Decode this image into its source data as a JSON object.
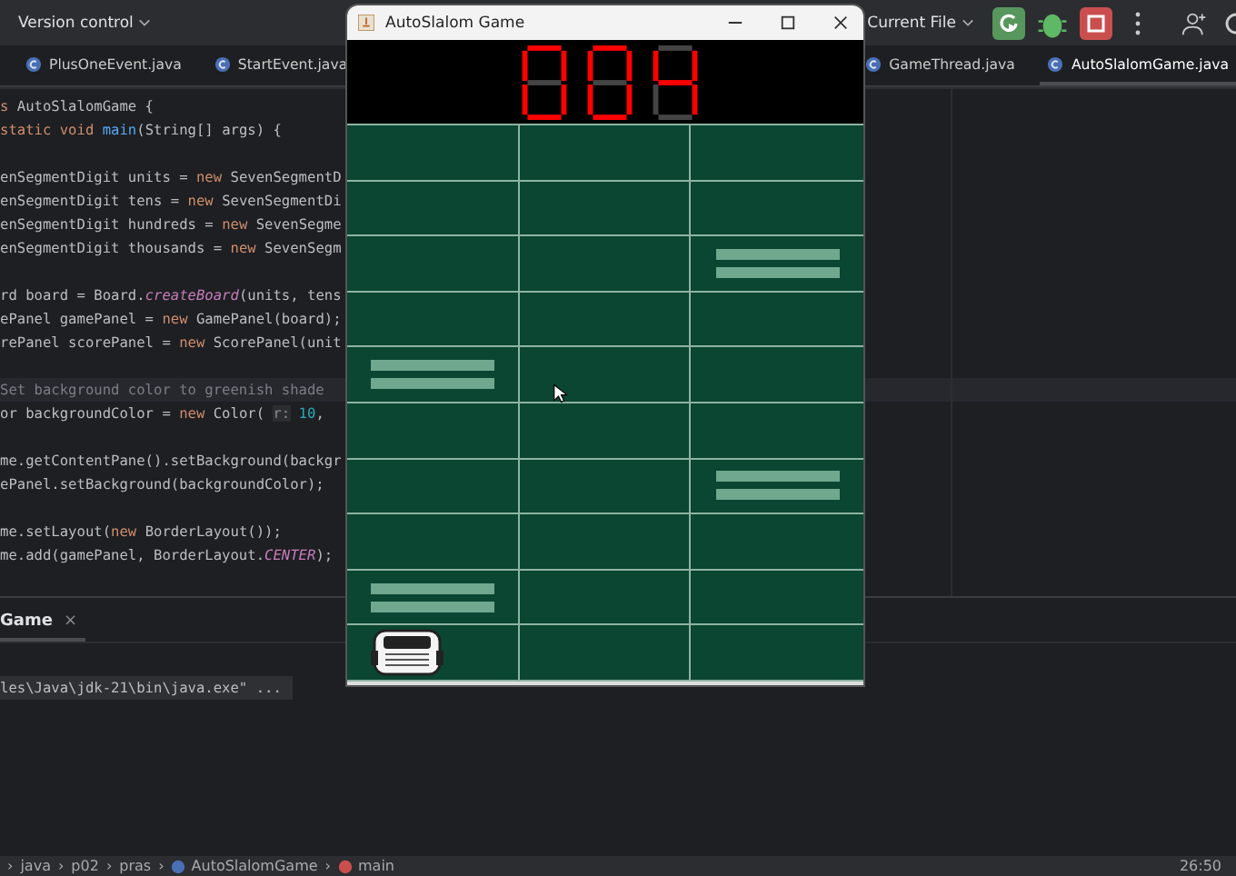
{
  "toolbar": {
    "vcs_label": "Version control",
    "run_config": "Current File"
  },
  "editor_tabs": [
    {
      "label": "PlusOneEvent.java",
      "selected": false
    },
    {
      "label": "StartEvent.java",
      "selected": false
    },
    {
      "label": "GameThread.java",
      "selected": false
    },
    {
      "label": "AutoSlalomGame.java",
      "selected": true
    }
  ],
  "code_lines": [
    {
      "tokens": [
        {
          "kind": "keyword",
          "text": "s "
        },
        {
          "kind": "plain",
          "text": "AutoSlalomGame {"
        }
      ]
    },
    {
      "tokens": [
        {
          "kind": "keyword",
          "text": "static void "
        },
        {
          "kind": "method",
          "text": "main"
        },
        {
          "kind": "plain",
          "text": "(String[] args) {"
        }
      ]
    },
    {
      "blank_before": true,
      "tokens": [
        {
          "kind": "plain",
          "text": "enSegmentDigit units = "
        },
        {
          "kind": "keyword",
          "text": "new "
        },
        {
          "kind": "plain",
          "text": "SevenSegmentD"
        }
      ]
    },
    {
      "tokens": [
        {
          "kind": "plain",
          "text": "enSegmentDigit tens = "
        },
        {
          "kind": "keyword",
          "text": "new "
        },
        {
          "kind": "plain",
          "text": "SevenSegmentDi"
        }
      ]
    },
    {
      "tokens": [
        {
          "kind": "plain",
          "text": "enSegmentDigit hundreds = "
        },
        {
          "kind": "keyword",
          "text": "new "
        },
        {
          "kind": "plain",
          "text": "SevenSegme"
        }
      ]
    },
    {
      "tokens": [
        {
          "kind": "plain",
          "text": "enSegmentDigit thousands = "
        },
        {
          "kind": "keyword",
          "text": "new "
        },
        {
          "kind": "plain",
          "text": "SevenSegm"
        }
      ]
    },
    {
      "blank_before": true,
      "tokens": [
        {
          "kind": "plain",
          "text": "rd board = Board."
        },
        {
          "kind": "italic",
          "text": "createBoard"
        },
        {
          "kind": "plain",
          "text": "(units, tens"
        }
      ]
    },
    {
      "tokens": [
        {
          "kind": "plain",
          "text": "ePanel gamePanel = "
        },
        {
          "kind": "keyword",
          "text": "new "
        },
        {
          "kind": "plain",
          "text": "GamePanel(board);"
        }
      ]
    },
    {
      "tokens": [
        {
          "kind": "plain",
          "text": "rePanel scorePanel = "
        },
        {
          "kind": "keyword",
          "text": "new "
        },
        {
          "kind": "plain",
          "text": "ScorePanel(unit"
        }
      ]
    },
    {
      "blank_before": true,
      "current": true,
      "tokens": [
        {
          "kind": "comment",
          "text": "Set background color to greenish shade"
        }
      ]
    },
    {
      "tokens": [
        {
          "kind": "plain",
          "text": "or backgroundColor = "
        },
        {
          "kind": "keyword",
          "text": "new "
        },
        {
          "kind": "plain",
          "text": "Color( "
        },
        {
          "kind": "hint",
          "text": "r:"
        },
        {
          "kind": "number",
          "text": " 10"
        },
        {
          "kind": "plain",
          "text": ","
        }
      ]
    },
    {
      "blank_before": true,
      "tokens": [
        {
          "kind": "plain",
          "text": "me.getContentPane().setBackground(backgr"
        }
      ]
    },
    {
      "tokens": [
        {
          "kind": "plain",
          "text": "ePanel.setBackground(backgroundColor);"
        }
      ]
    },
    {
      "blank_before": true,
      "tokens": [
        {
          "kind": "plain",
          "text": "me.setLayout("
        },
        {
          "kind": "keyword",
          "text": "new "
        },
        {
          "kind": "plain",
          "text": "BorderLayout());"
        }
      ]
    },
    {
      "tokens": [
        {
          "kind": "plain",
          "text": "me.add(gamePanel, BorderLayout."
        },
        {
          "kind": "italic",
          "text": "CENTER"
        },
        {
          "kind": "plain",
          "text": ");"
        }
      ]
    }
  ],
  "run_panel": {
    "tab": "Game",
    "close": "×",
    "console_line": "les\\Java\\jdk-21\\bin\\java.exe\" ..."
  },
  "status_bar": {
    "breadcrumbs": [
      {
        "kind": "text",
        "label": "java"
      },
      {
        "kind": "text",
        "label": "p02"
      },
      {
        "kind": "text",
        "label": "pras"
      },
      {
        "kind": "class",
        "label": "AutoSlalomGame"
      },
      {
        "kind": "method",
        "label": "main"
      }
    ],
    "separator": "›",
    "position": "26:50"
  },
  "game_window": {
    "title": "AutoSlalom Game",
    "score_digits": [
      {
        "a": true,
        "b": true,
        "c": true,
        "d": true,
        "e": true,
        "f": true,
        "g": false
      },
      {
        "a": true,
        "b": true,
        "c": true,
        "d": true,
        "e": true,
        "f": true,
        "g": false
      },
      {
        "a": false,
        "b": true,
        "c": true,
        "d": false,
        "e": false,
        "f": true,
        "g": true
      }
    ],
    "board_rows": [
      {
        "cells": [
          {
            "kind": "empty"
          },
          {
            "kind": "empty"
          },
          {
            "kind": "empty"
          }
        ]
      },
      {
        "cells": [
          {
            "kind": "empty"
          },
          {
            "kind": "empty"
          },
          {
            "kind": "empty"
          }
        ]
      },
      {
        "cells": [
          {
            "kind": "empty"
          },
          {
            "kind": "empty"
          },
          {
            "kind": "obstacle"
          }
        ]
      },
      {
        "cells": [
          {
            "kind": "empty"
          },
          {
            "kind": "empty"
          },
          {
            "kind": "empty"
          }
        ]
      },
      {
        "cells": [
          {
            "kind": "obstacle"
          },
          {
            "kind": "empty"
          },
          {
            "kind": "empty"
          }
        ]
      },
      {
        "cells": [
          {
            "kind": "empty"
          },
          {
            "kind": "empty"
          },
          {
            "kind": "empty"
          }
        ]
      },
      {
        "cells": [
          {
            "kind": "empty"
          },
          {
            "kind": "empty"
          },
          {
            "kind": "obstacle"
          }
        ]
      },
      {
        "cells": [
          {
            "kind": "empty"
          },
          {
            "kind": "empty"
          },
          {
            "kind": "empty"
          }
        ]
      },
      {
        "cells": [
          {
            "kind": "obstacle"
          },
          {
            "kind": "empty"
          },
          {
            "kind": "empty"
          }
        ]
      },
      {
        "cells": [
          {
            "kind": "car"
          },
          {
            "kind": "empty"
          },
          {
            "kind": "empty"
          }
        ]
      }
    ]
  }
}
